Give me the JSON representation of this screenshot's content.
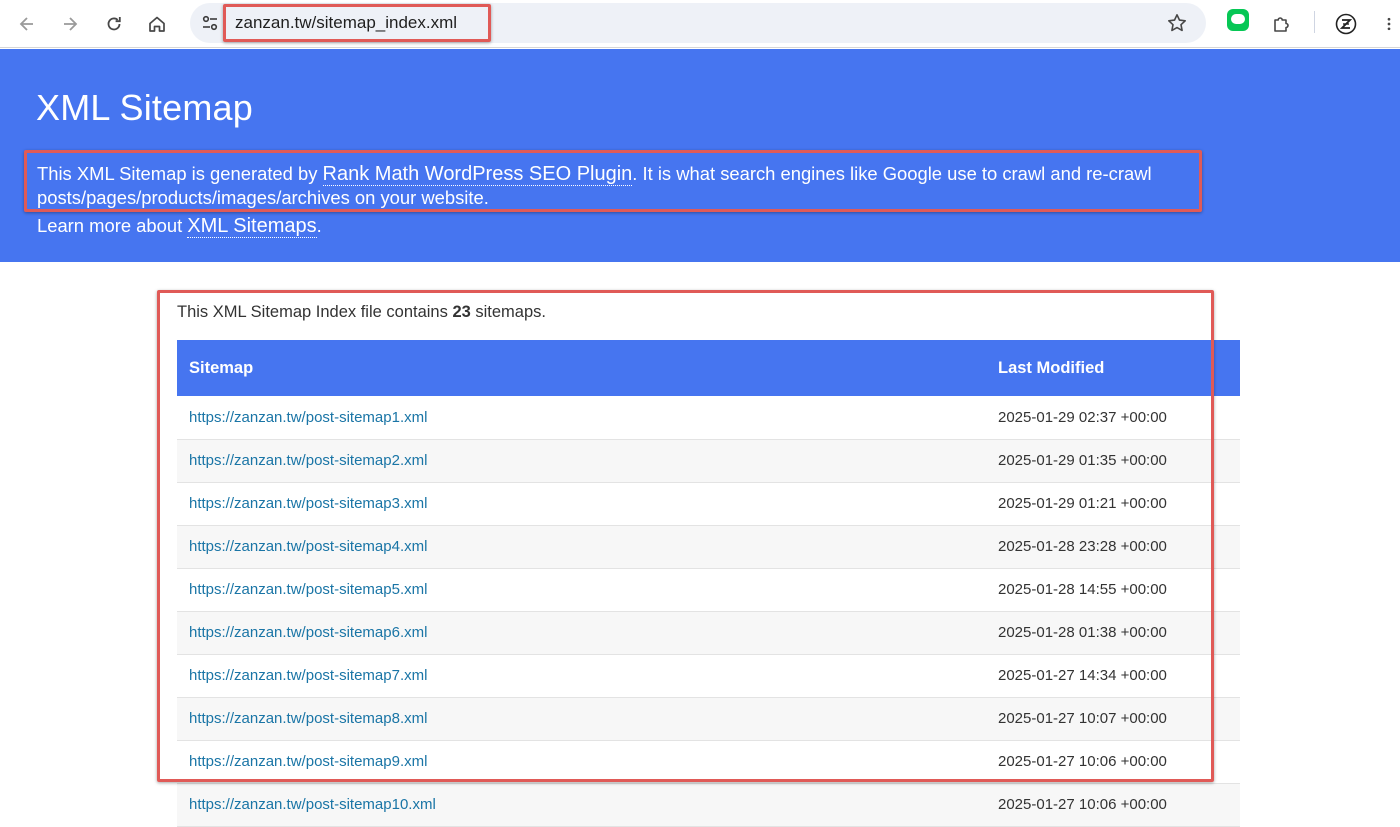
{
  "browser": {
    "url": "zanzan.tw/sitemap_index.xml"
  },
  "header": {
    "title": "XML Sitemap",
    "intro_prefix": "This XML Sitemap is generated by ",
    "intro_link": "Rank Math WordPress SEO Plugin",
    "intro_suffix": ". It is what search engines like Google use to crawl and re-crawl posts/pages/products/images/archives on your website.",
    "learn_prefix": "Learn more about ",
    "learn_link": "XML Sitemaps",
    "learn_suffix": ".",
    "color": "#4675f0"
  },
  "content": {
    "summary_prefix": "This XML Sitemap Index file contains ",
    "summary_count": "23",
    "summary_suffix": " sitemaps.",
    "columns": [
      "Sitemap",
      "Last Modified"
    ],
    "rows": [
      {
        "url": "https://zanzan.tw/post-sitemap1.xml",
        "modified": "2025-01-29 02:37 +00:00"
      },
      {
        "url": "https://zanzan.tw/post-sitemap2.xml",
        "modified": "2025-01-29 01:35 +00:00"
      },
      {
        "url": "https://zanzan.tw/post-sitemap3.xml",
        "modified": "2025-01-29 01:21 +00:00"
      },
      {
        "url": "https://zanzan.tw/post-sitemap4.xml",
        "modified": "2025-01-28 23:28 +00:00"
      },
      {
        "url": "https://zanzan.tw/post-sitemap5.xml",
        "modified": "2025-01-28 14:55 +00:00"
      },
      {
        "url": "https://zanzan.tw/post-sitemap6.xml",
        "modified": "2025-01-28 01:38 +00:00"
      },
      {
        "url": "https://zanzan.tw/post-sitemap7.xml",
        "modified": "2025-01-27 14:34 +00:00"
      },
      {
        "url": "https://zanzan.tw/post-sitemap8.xml",
        "modified": "2025-01-27 10:07 +00:00"
      },
      {
        "url": "https://zanzan.tw/post-sitemap9.xml",
        "modified": "2025-01-27 10:06 +00:00"
      },
      {
        "url": "https://zanzan.tw/post-sitemap10.xml",
        "modified": "2025-01-27 10:06 +00:00"
      }
    ]
  },
  "icons": [
    "back-icon",
    "forward-icon",
    "reload-icon",
    "home-icon",
    "site-info-icon",
    "bookmark-star-icon",
    "line-extension-icon",
    "extensions-puzzle-icon",
    "profile-z-icon",
    "menu-kebab-icon"
  ],
  "annotation_color": "#e05a57"
}
